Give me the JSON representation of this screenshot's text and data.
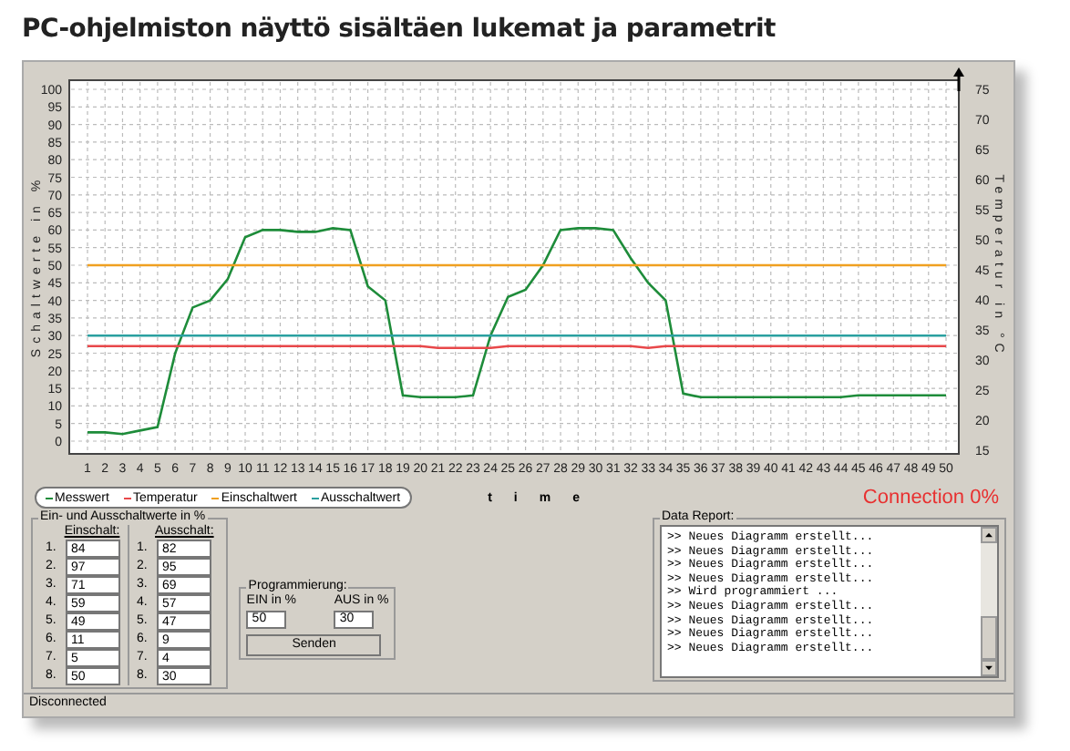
{
  "caption": "PC-ohjelmiston näyttö sisältäen lukemat ja parametrit",
  "chart": {
    "chart_data": {
      "type": "line",
      "xlabel": "time",
      "ylabel": "Schaltwerte in %",
      "x": [
        1,
        2,
        3,
        4,
        5,
        6,
        7,
        8,
        9,
        10,
        11,
        12,
        13,
        14,
        15,
        16,
        17,
        18,
        19,
        20,
        21,
        22,
        23,
        24,
        25,
        26,
        27,
        28,
        29,
        30,
        31,
        32,
        33,
        34,
        35,
        36,
        37,
        38,
        39,
        40,
        41,
        42,
        43,
        44,
        45,
        46,
        47,
        48,
        49,
        50
      ],
      "series": [
        {
          "name": "Messwert",
          "color": "#1e8c3a",
          "values": [
            2.5,
            2.5,
            2,
            3,
            4,
            25,
            38,
            40,
            46,
            58,
            60,
            60,
            59.5,
            59.5,
            60.5,
            60,
            44,
            40,
            13,
            12.5,
            12.5,
            12.5,
            13,
            30,
            41,
            43,
            50,
            60,
            60.5,
            60.5,
            60,
            52,
            45,
            40,
            13.5,
            12.5,
            12.5,
            12.5,
            12.5,
            12.5,
            12.5,
            12.5,
            12.5,
            12.5,
            13,
            13,
            13,
            13,
            13,
            13
          ]
        },
        {
          "name": "Temperatur",
          "color": "#e8484a",
          "values": [
            27,
            27,
            27,
            27,
            27,
            27,
            27,
            27,
            27,
            27,
            27,
            27,
            27,
            27,
            27,
            27,
            27,
            27,
            27,
            27,
            26.5,
            26.5,
            26.5,
            26.5,
            27,
            27,
            27,
            27,
            27,
            27,
            27,
            27,
            26.5,
            27,
            27,
            27,
            27,
            27,
            27,
            27,
            27,
            27,
            27,
            27,
            27,
            27,
            27,
            27,
            27,
            27
          ]
        },
        {
          "name": "Einschaltwert",
          "color": "#f0a020",
          "values": [
            50,
            50,
            50,
            50,
            50,
            50,
            50,
            50,
            50,
            50,
            50,
            50,
            50,
            50,
            50,
            50,
            50,
            50,
            50,
            50,
            50,
            50,
            50,
            50,
            50,
            50,
            50,
            50,
            50,
            50,
            50,
            50,
            50,
            50,
            50,
            50,
            50,
            50,
            50,
            50,
            50,
            50,
            50,
            50,
            50,
            50,
            50,
            50,
            50,
            50
          ]
        },
        {
          "name": "Ausschaltwert",
          "color": "#2aa0a0",
          "values": [
            30,
            30,
            30,
            30,
            30,
            30,
            30,
            30,
            30,
            30,
            30,
            30,
            30,
            30,
            30,
            30,
            30,
            30,
            30,
            30,
            30,
            30,
            30,
            30,
            30,
            30,
            30,
            30,
            30,
            30,
            30,
            30,
            30,
            30,
            30,
            30,
            30,
            30,
            30,
            30,
            30,
            30,
            30,
            30,
            30,
            30,
            30,
            30,
            30,
            30
          ]
        }
      ],
      "xlim": [
        1,
        50
      ],
      "ylim": [
        0,
        100
      ],
      "grid": true,
      "legend": "bottom-left",
      "xticks": [
        1,
        2,
        3,
        4,
        5,
        6,
        7,
        8,
        9,
        10,
        11,
        12,
        13,
        14,
        15,
        16,
        17,
        18,
        19,
        20,
        21,
        22,
        23,
        24,
        25,
        26,
        27,
        28,
        29,
        30,
        31,
        32,
        33,
        34,
        35,
        36,
        37,
        38,
        39,
        40,
        41,
        42,
        43,
        44,
        45,
        46,
        47,
        48,
        49,
        50
      ],
      "yticks": [
        0,
        5,
        10,
        15,
        20,
        25,
        30,
        35,
        40,
        45,
        50,
        55,
        60,
        65,
        70,
        75,
        80,
        85,
        90,
        95,
        100
      ]
    },
    "right_axis": {
      "label": "Temperatur in °C",
      "ticks": [
        "75",
        "70",
        "65",
        "60",
        "55",
        "50",
        "45",
        "40",
        "35",
        "30",
        "25",
        "20",
        "15"
      ]
    }
  },
  "connection": "Connection 0%",
  "switch_values": {
    "title": "Ein- und Ausschaltwerte in %",
    "on_header": "Einschalt:",
    "off_header": "Ausschalt:",
    "rows": [
      {
        "on_label": "1.",
        "on": "84",
        "off_label": "1.",
        "off": "82"
      },
      {
        "on_label": "2.",
        "on": "97",
        "off_label": "2.",
        "off": "95"
      },
      {
        "on_label": "3.",
        "on": "71",
        "off_label": "3.",
        "off": "69"
      },
      {
        "on_label": "4.",
        "on": "59",
        "off_label": "4.",
        "off": "57"
      },
      {
        "on_label": "5.",
        "on": "49",
        "off_label": "5.",
        "off": "47"
      },
      {
        "on_label": "6.",
        "on": "11",
        "off_label": "6.",
        "off": "9"
      },
      {
        "on_label": "7.",
        "on": "5",
        "off_label": "7.",
        "off": "4"
      },
      {
        "on_label": "8.",
        "on": "50",
        "off_label": "8.",
        "off": "30"
      }
    ]
  },
  "programming": {
    "title": "Programmierung:",
    "on_label": "EIN in %",
    "on_value": "50",
    "off_label": "AUS in %",
    "off_value": "30",
    "button": "Senden"
  },
  "data_report": {
    "title": "Data Report:",
    "lines": [
      ">> Neues Diagramm erstellt...",
      ">> Neues Diagramm erstellt...",
      ">> Neues Diagramm erstellt...",
      ">> Neues Diagramm erstellt...",
      ">> Wird programmiert ...",
      ">> Neues Diagramm erstellt...",
      ">> Neues Diagramm erstellt...",
      ">> Neues Diagramm erstellt...",
      ">> Neues Diagramm erstellt..."
    ]
  },
  "status_bar": "Disconnected"
}
